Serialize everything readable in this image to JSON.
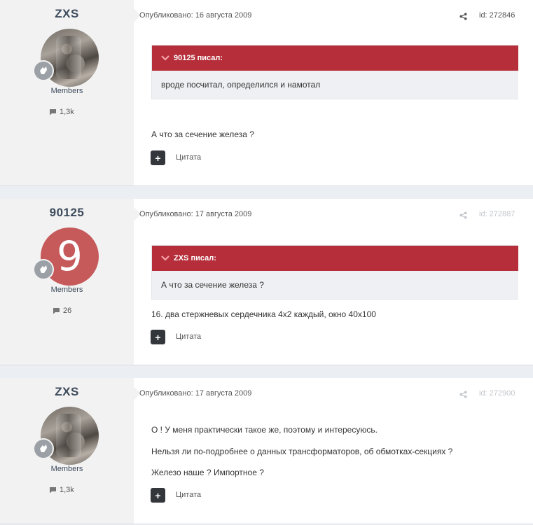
{
  "posts": [
    {
      "username": "ZXS",
      "group": "Members",
      "count": "1,3k",
      "date": "Опубликовано: 16 августа 2009",
      "id": "id: 272846",
      "quote_author": "90125 писал:",
      "quote_text": "вроде посчитал, определился и намотал",
      "lines": [
        "А что за сечение железа ?"
      ],
      "quote_button": "Цитата"
    },
    {
      "username": "90125",
      "avatar_letter": "9",
      "group": "Members",
      "count": "26",
      "date": "Опубликовано: 17 августа 2009",
      "id": "id: 272887",
      "quote_author": "ZXS писал:",
      "quote_text": "А что за сечение железа ?",
      "lines": [
        "16. два стержневых сердечника 4х2 каждый, окно 40х100"
      ],
      "quote_button": "Цитата"
    },
    {
      "username": "ZXS",
      "group": "Members",
      "count": "1,3k",
      "date": "Опубликовано: 17 августа 2009",
      "id": "id: 272900",
      "lines": [
        "О ! У меня практически такое же, поэтому и интересуюсь.",
        "Нельзя ли по-подробнее о данных трансформаторов, об обмотках-секциях ?",
        "Железо наше ? Импортное ?"
      ],
      "quote_button": "Цитата"
    }
  ],
  "colors": {
    "quote_header": "#b52e3a",
    "letter_avatar": "#c65a5a",
    "author_panel": "#f2f2f2",
    "page_bg": "#ebeef2"
  },
  "icons": {
    "share": "share-icon",
    "comment": "comment-icon",
    "rank": "rank-badge-icon",
    "chevron": "chevron-down-icon",
    "plus": "plus-icon"
  }
}
